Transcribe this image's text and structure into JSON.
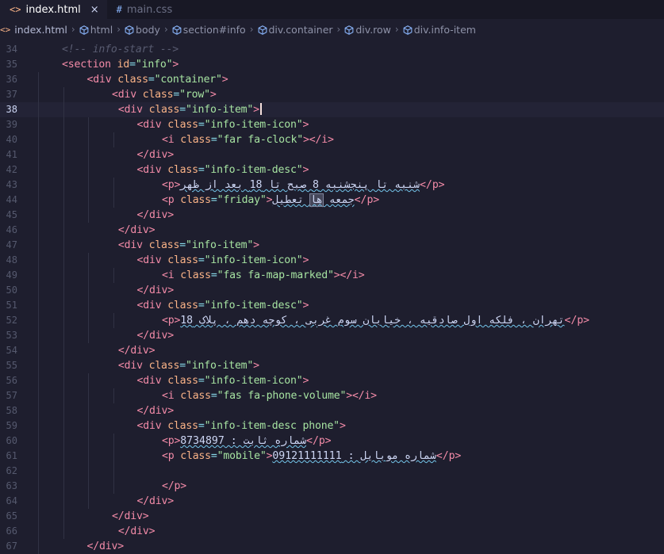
{
  "tabs": [
    {
      "name": "index.html",
      "icon": "<>",
      "active": true,
      "close": "×"
    },
    {
      "name": "main.css",
      "icon": "#",
      "active": false
    }
  ],
  "breadcrumb": {
    "file_icon": "<>",
    "items": [
      "index.html",
      "html",
      "body",
      "section#info",
      "div.container",
      "div.row",
      "div.info-item"
    ]
  },
  "editor": {
    "first_line": 34,
    "current_line": 38,
    "lines": [
      {
        "indent": 0,
        "tokens": [
          [
            "com",
            "<!-- info-start -->"
          ]
        ]
      },
      {
        "indent": 0,
        "tokens": [
          [
            "tag",
            "<section "
          ],
          [
            "attr",
            "id"
          ],
          [
            "eq",
            "="
          ],
          [
            "str",
            "\"info\""
          ],
          [
            "tag",
            ">"
          ]
        ]
      },
      {
        "indent": 1,
        "tokens": [
          [
            "tag",
            "<div "
          ],
          [
            "attr",
            "class"
          ],
          [
            "eq",
            "="
          ],
          [
            "str",
            "\"container\""
          ],
          [
            "tag",
            ">"
          ]
        ]
      },
      {
        "indent": 2,
        "tokens": [
          [
            "tag",
            "<div "
          ],
          [
            "attr",
            "class"
          ],
          [
            "eq",
            "="
          ],
          [
            "str",
            "\"row\""
          ],
          [
            "tag",
            ">"
          ]
        ]
      },
      {
        "indent": 2.25,
        "tokens": [
          [
            "tag",
            "<div "
          ],
          [
            "attr",
            "class"
          ],
          [
            "eq",
            "="
          ],
          [
            "str",
            "\"info-item\""
          ],
          [
            "tag",
            ">"
          ]
        ],
        "cursor": true
      },
      {
        "indent": 3,
        "tokens": [
          [
            "tag",
            "<div "
          ],
          [
            "attr",
            "class"
          ],
          [
            "eq",
            "="
          ],
          [
            "str",
            "\"info-item-icon\""
          ],
          [
            "tag",
            ">"
          ]
        ]
      },
      {
        "indent": 4,
        "tokens": [
          [
            "tag",
            "<i "
          ],
          [
            "attr",
            "class"
          ],
          [
            "eq",
            "="
          ],
          [
            "str",
            "\"far fa-clock\""
          ],
          [
            "tag",
            "></i>"
          ]
        ]
      },
      {
        "indent": 3,
        "tokens": [
          [
            "tag",
            "</div>"
          ]
        ]
      },
      {
        "indent": 3,
        "tokens": [
          [
            "tag",
            "<div "
          ],
          [
            "attr",
            "class"
          ],
          [
            "eq",
            "="
          ],
          [
            "str",
            "\"info-item-desc\""
          ],
          [
            "tag",
            ">"
          ]
        ]
      },
      {
        "indent": 4,
        "tokens": [
          [
            "tag",
            "<p>"
          ],
          [
            "fa",
            "شنبه تا پنجشنبه 8 صبح تا 18 بعد از ظهر"
          ],
          [
            "tag",
            "</p>"
          ]
        ]
      },
      {
        "indent": 4,
        "tokens": [
          [
            "tag",
            "<p "
          ],
          [
            "attr",
            "class"
          ],
          [
            "eq",
            "="
          ],
          [
            "str",
            "\"friday\""
          ],
          [
            "tag",
            ">"
          ],
          [
            "fa",
            "جمعه ها تعطیل"
          ],
          [
            "tag",
            "</p>"
          ]
        ]
      },
      {
        "indent": 3,
        "tokens": [
          [
            "tag",
            "</div>"
          ]
        ]
      },
      {
        "indent": 2.25,
        "tokens": [
          [
            "tag",
            "</div>"
          ]
        ]
      },
      {
        "indent": 2.25,
        "tokens": [
          [
            "tag",
            "<div "
          ],
          [
            "attr",
            "class"
          ],
          [
            "eq",
            "="
          ],
          [
            "str",
            "\"info-item\""
          ],
          [
            "tag",
            ">"
          ]
        ]
      },
      {
        "indent": 3,
        "tokens": [
          [
            "tag",
            "<div "
          ],
          [
            "attr",
            "class"
          ],
          [
            "eq",
            "="
          ],
          [
            "str",
            "\"info-item-icon\""
          ],
          [
            "tag",
            ">"
          ]
        ]
      },
      {
        "indent": 4,
        "tokens": [
          [
            "tag",
            "<i "
          ],
          [
            "attr",
            "class"
          ],
          [
            "eq",
            "="
          ],
          [
            "str",
            "\"fas fa-map-marked\""
          ],
          [
            "tag",
            "></i>"
          ]
        ]
      },
      {
        "indent": 3,
        "tokens": [
          [
            "tag",
            "</div>"
          ]
        ]
      },
      {
        "indent": 3,
        "tokens": [
          [
            "tag",
            "<div "
          ],
          [
            "attr",
            "class"
          ],
          [
            "eq",
            "="
          ],
          [
            "str",
            "\"info-item-desc\""
          ],
          [
            "tag",
            ">"
          ]
        ]
      },
      {
        "indent": 4,
        "tokens": [
          [
            "tag",
            "<p>"
          ],
          [
            "fa",
            "تهران ، فلکه اول صادقیه ، خیابان سوم غربی ، کوچه دهم ، پلاک 18"
          ],
          [
            "tag",
            "</p>"
          ]
        ]
      },
      {
        "indent": 3,
        "tokens": [
          [
            "tag",
            "</div>"
          ]
        ]
      },
      {
        "indent": 2.25,
        "tokens": [
          [
            "tag",
            "</div>"
          ]
        ]
      },
      {
        "indent": 2.25,
        "tokens": [
          [
            "tag",
            "<div "
          ],
          [
            "attr",
            "class"
          ],
          [
            "eq",
            "="
          ],
          [
            "str",
            "\"info-item\""
          ],
          [
            "tag",
            ">"
          ]
        ]
      },
      {
        "indent": 3,
        "tokens": [
          [
            "tag",
            "<div "
          ],
          [
            "attr",
            "class"
          ],
          [
            "eq",
            "="
          ],
          [
            "str",
            "\"info-item-icon\""
          ],
          [
            "tag",
            ">"
          ]
        ]
      },
      {
        "indent": 4,
        "tokens": [
          [
            "tag",
            "<i "
          ],
          [
            "attr",
            "class"
          ],
          [
            "eq",
            "="
          ],
          [
            "str",
            "\"fas fa-phone-volume\""
          ],
          [
            "tag",
            "></i>"
          ]
        ]
      },
      {
        "indent": 3,
        "tokens": [
          [
            "tag",
            "</div>"
          ]
        ]
      },
      {
        "indent": 3,
        "tokens": [
          [
            "tag",
            "<div "
          ],
          [
            "attr",
            "class"
          ],
          [
            "eq",
            "="
          ],
          [
            "str",
            "\"info-item-desc phone\""
          ],
          [
            "tag",
            ">"
          ]
        ]
      },
      {
        "indent": 4,
        "tokens": [
          [
            "tag",
            "<p>"
          ],
          [
            "fa",
            "شماره ثابت : 8734897"
          ],
          [
            "tag",
            "</p>"
          ]
        ]
      },
      {
        "indent": 4,
        "tokens": [
          [
            "tag",
            "<p "
          ],
          [
            "attr",
            "class"
          ],
          [
            "eq",
            "="
          ],
          [
            "str",
            "\"mobile\""
          ],
          [
            "tag",
            ">"
          ],
          [
            "fa",
            "شماره موبایل : 09121111111"
          ],
          [
            "tag",
            "</p>"
          ]
        ]
      },
      {
        "indent": 4,
        "tokens": []
      },
      {
        "indent": 4,
        "tokens": [
          [
            "tag",
            "</p>"
          ]
        ]
      },
      {
        "indent": 3,
        "tokens": [
          [
            "tag",
            "</div>"
          ]
        ]
      },
      {
        "indent": 2,
        "tokens": [
          [
            "tag",
            "</div>"
          ]
        ]
      },
      {
        "indent": 2.25,
        "tokens": [
          [
            "tag",
            "</div>"
          ]
        ]
      },
      {
        "indent": 1,
        "tokens": [
          [
            "tag",
            "</div>"
          ]
        ]
      }
    ]
  }
}
